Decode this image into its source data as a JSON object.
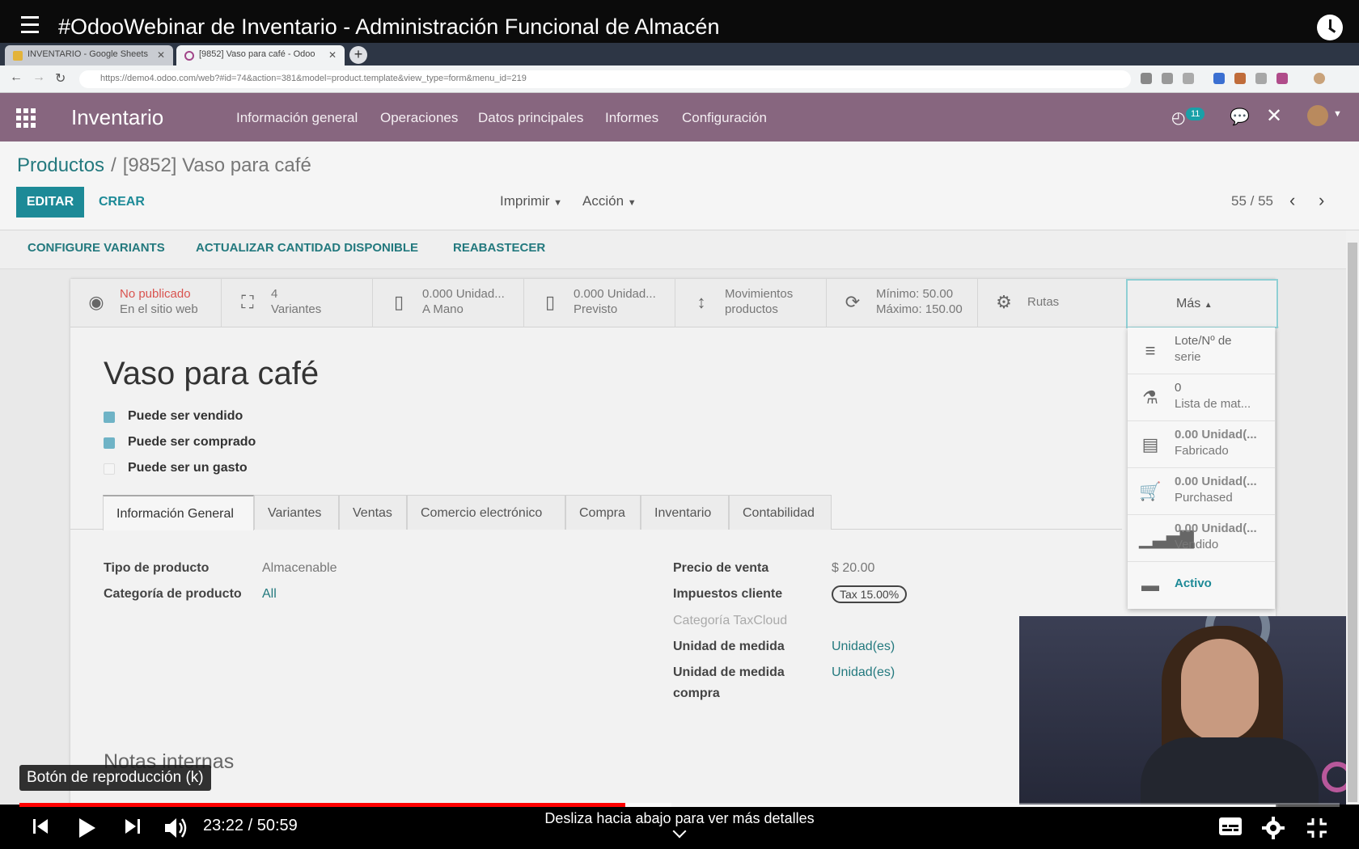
{
  "video": {
    "title": "#OdooWebinar de Inventario - Administración Funcional de Almacén",
    "tooltip": "Botón de reproducción (k)",
    "time": "23:22 / 50:59",
    "swipe_hint": "Desliza hacia abajo para ver más detalles",
    "progress_fraction": 0.459,
    "buffered_fraction": 0.494
  },
  "browser": {
    "tabs": [
      {
        "label": "INVENTARIO - Google Sheets"
      },
      {
        "label": "[9852] Vaso para café - Odoo"
      }
    ],
    "url": "https://demo4.odoo.com/web?#id=74&action=381&model=product.template&view_type=form&menu_id=219"
  },
  "odoo": {
    "app_name": "Inventario",
    "menu": [
      "Información general",
      "Operaciones",
      "Datos principales",
      "Informes",
      "Configuración"
    ],
    "activity_count": "11",
    "breadcrumb": {
      "parent": "Productos",
      "current": "[9852] Vaso para café"
    },
    "buttons": {
      "edit": "EDITAR",
      "create": "CREAR",
      "print": "Imprimir",
      "action": "Acción"
    },
    "pager": "55 / 55",
    "header_buttons": [
      "CONFIGURE VARIANTS",
      "ACTUALIZAR CANTIDAD DISPONIBLE",
      "REABASTECER"
    ],
    "smart_buttons": [
      {
        "line1": "No publicado",
        "line2": "En el sitio web",
        "icon": "globe-icon"
      },
      {
        "line1": "4",
        "line2": "Variantes",
        "icon": "sitemap-icon"
      },
      {
        "line1": "0.000 Unidad...",
        "line2": "A Mano",
        "icon": "building-icon"
      },
      {
        "line1": "0.000 Unidad...",
        "line2": "Previsto",
        "icon": "building-icon"
      },
      {
        "line1": "Movimientos",
        "line2": "productos",
        "icon": "arrows-vertical-icon"
      },
      {
        "line1": "Mínimo:  50.00",
        "line2": "Máximo:  150.00",
        "icon": "refresh-icon"
      },
      {
        "line1": "Rutas",
        "line2": "",
        "icon": "cogs-icon"
      }
    ],
    "more_label": "Más",
    "more_items": [
      {
        "line1": "Lote/Nº de",
        "line2": "serie",
        "icon": "bars-icon"
      },
      {
        "line1": "0",
        "line2": "Lista de mat...",
        "icon": "flask-icon"
      },
      {
        "line1": "0.00 Unidad(...",
        "line2": "Fabricado",
        "icon": "list-alt-icon"
      },
      {
        "line1": "0.00 Unidad(...",
        "line2": "Purchased",
        "icon": "cart-icon"
      },
      {
        "line1": "0.00 Unidad(...",
        "line2": "Vendido",
        "icon": "signal-icon"
      },
      {
        "line1": "Activo",
        "line2": "",
        "icon": "archive-icon"
      }
    ],
    "product_name": "Vaso para café",
    "checkboxes": [
      {
        "label": "Puede ser vendido",
        "checked": true
      },
      {
        "label": "Puede ser comprado",
        "checked": true
      },
      {
        "label": "Puede ser un gasto",
        "checked": false
      }
    ],
    "notebook_tabs": [
      "Información General",
      "Variantes",
      "Ventas",
      "Comercio electrónico",
      "Compra",
      "Inventario",
      "Contabilidad"
    ],
    "left_fields": [
      {
        "label": "Tipo de producto",
        "value": "Almacenable"
      },
      {
        "label": "Categoría de producto",
        "value": "All"
      }
    ],
    "right_fields": [
      {
        "label": "Precio de venta",
        "value": "$ 20.00"
      },
      {
        "label": "Impuestos cliente",
        "value": "Tax 15.00%"
      },
      {
        "label": "Categoría TaxCloud",
        "value": ""
      },
      {
        "label": "Unidad de medida",
        "value": "Unidad(es)"
      },
      {
        "label": "Unidad de medida",
        "label2": "compra",
        "value": "Unidad(es)"
      }
    ],
    "notes_title": "Notas internas"
  },
  "colors": {
    "navbar": "#87667f",
    "primary": "#1d8a97",
    "progress": "#ff0000"
  }
}
